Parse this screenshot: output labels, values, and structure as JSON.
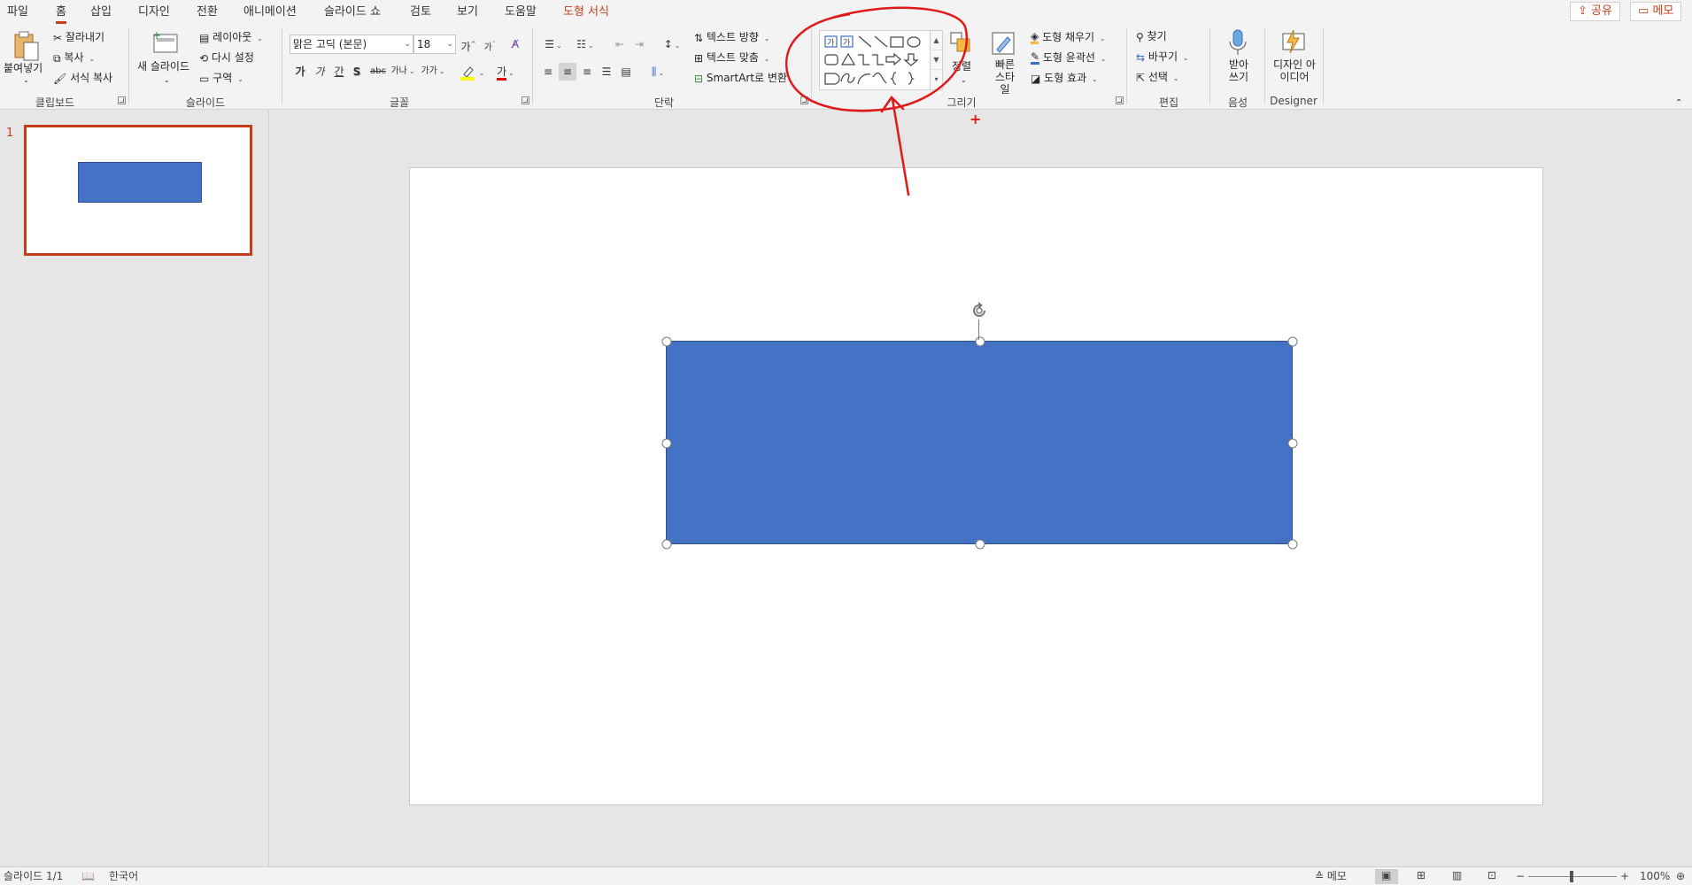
{
  "tabs": [
    {
      "label": "파일"
    },
    {
      "label": "홈"
    },
    {
      "label": "삽입"
    },
    {
      "label": "디자인"
    },
    {
      "label": "전환"
    },
    {
      "label": "애니메이션"
    },
    {
      "label": "슬라이드 쇼"
    },
    {
      "label": "검토"
    },
    {
      "label": "보기"
    },
    {
      "label": "도움말"
    },
    {
      "label": "도형 서식"
    }
  ],
  "top_right": {
    "share": "공유",
    "comments": "메모"
  },
  "clipboard": {
    "paste": "붙여넣기",
    "cut": "잘라내기",
    "copy": "복사",
    "format_painter": "서식 복사",
    "group": "클립보드"
  },
  "slides_group": {
    "new_slide": "새 슬라이드",
    "layout": "레이아웃",
    "reset": "다시 설정",
    "section": "구역",
    "group": "슬라이드"
  },
  "font": {
    "face": "맑은 고딕 (본문)",
    "size": "18",
    "grow": "가",
    "shrink": "가",
    "bold": "가",
    "italic": "가",
    "underline": "간",
    "shadow": "S",
    "strike": "abc",
    "spacing": "가나",
    "case": "가가",
    "highlight_color": "#ffff00",
    "font_color_glyph": "가",
    "font_color": "#e00000",
    "group": "글꼴"
  },
  "paragraph": {
    "text_direction": "텍스트 방향",
    "align_text": "텍스트 맞춤",
    "smartart": "SmartArt로 변환",
    "group": "단락"
  },
  "drawing": {
    "arrange": "정렬",
    "quick_styles": "빠른 스타일",
    "fill": "도형 채우기",
    "outline": "도형 윤곽선",
    "effects": "도형 효과",
    "group": "그리기"
  },
  "editing": {
    "find": "찾기",
    "replace": "바꾸기",
    "select": "선택",
    "group": "편집"
  },
  "voice": {
    "dictate": "받아 쓰기",
    "group": "음성"
  },
  "designer": {
    "design_ideas": "디자인 아이디어",
    "group": "Designer"
  },
  "thumbnails": [
    {
      "number": "1"
    }
  ],
  "status": {
    "slide_info": "슬라이드 1/1",
    "language": "한국어",
    "notes": "메모",
    "zoom": "100%"
  },
  "colors": {
    "accent": "#c43e1c",
    "shape_fill": "#4472c4",
    "shape_border": "#2f528f",
    "annotation": "#e01a1a"
  }
}
